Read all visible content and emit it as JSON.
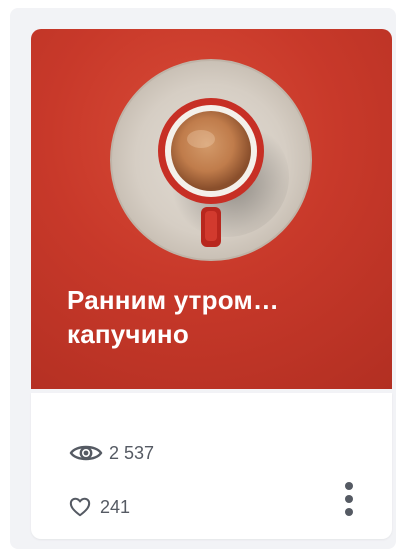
{
  "card": {
    "title_line1": "Ранним утром…",
    "title_line2": "капучино",
    "views": "2 537",
    "likes": "241",
    "icons": {
      "views": "eye-icon",
      "likes": "heart-icon",
      "menu": "more-vertical-icon",
      "cover": "coffee-cup-image"
    },
    "colors": {
      "cover_background": "#c8392a",
      "title_text": "#ffffff",
      "stat_text": "#555a63",
      "panel_background": "#f2f3f6"
    }
  }
}
